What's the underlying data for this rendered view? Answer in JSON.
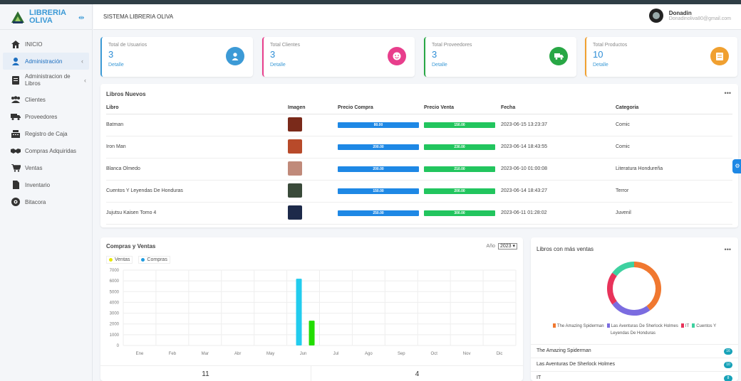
{
  "brand": {
    "line1": "LIBRERIA",
    "line2": "OLIVA",
    "collapse_icon": "collapse-icon"
  },
  "sidebar": {
    "items": [
      {
        "label": "INICIO",
        "icon": "home-icon"
      },
      {
        "label": "Administración",
        "icon": "user-icon",
        "active": true
      },
      {
        "label": "Administracion de Libros",
        "icon": "book-icon"
      },
      {
        "label": "Clientes",
        "icon": "users-icon"
      },
      {
        "label": "Proveedores",
        "icon": "truck-icon"
      },
      {
        "label": "Registro de Caja",
        "icon": "cash-register-icon"
      },
      {
        "label": "Compras Adquiridas",
        "icon": "handshake-icon"
      },
      {
        "label": "Ventas",
        "icon": "cart-icon"
      },
      {
        "label": "Inventario",
        "icon": "file-icon"
      },
      {
        "label": "Bitacora",
        "icon": "eye-icon"
      }
    ]
  },
  "header": {
    "title": "SISTEMA LIBRERIA OLIVA",
    "user_name": "Donadin",
    "user_email": "Donadinoliva80@gmail.com"
  },
  "stats": [
    {
      "label": "Total de Usuarios",
      "value": "3",
      "link": "Detalle",
      "color": "#3c9ad6",
      "icon": "user-icon"
    },
    {
      "label": "Total Clientes",
      "value": "3",
      "link": "Detalle",
      "color": "#e83e8c",
      "icon": "smile-icon"
    },
    {
      "label": "Total Proveedores",
      "value": "3",
      "link": "Detalle",
      "color": "#28a745",
      "icon": "truck-icon"
    },
    {
      "label": "Total Productos",
      "value": "10",
      "link": "Detalle",
      "color": "#f0a030",
      "icon": "box-icon"
    }
  ],
  "libros": {
    "title": "Libros Nuevos",
    "headers": [
      "Libro",
      "Imagen",
      "Precio Compra",
      "Precio Venta",
      "Fecha",
      "Categoria"
    ],
    "rows": [
      {
        "libro": "Batman",
        "compra": "80.00",
        "venta": "150.00",
        "fecha": "2023-06-15 13:23:37",
        "categoria": "Comic",
        "img": "#7a2a1a"
      },
      {
        "libro": "Iron Man",
        "compra": "200.00",
        "venta": "230.00",
        "fecha": "2023-06-14 18:43:55",
        "categoria": "Comic",
        "img": "#b84a2a"
      },
      {
        "libro": "Blanca Olmedo",
        "compra": "200.00",
        "venta": "210.00",
        "fecha": "2023-06-10 01:00:08",
        "categoria": "Literatura Hondureña",
        "img": "#c08a7a"
      },
      {
        "libro": "Cuentos Y Leyendas De Honduras",
        "compra": "150.00",
        "venta": "200.00",
        "fecha": "2023-06-14 18:43:27",
        "categoria": "Terror",
        "img": "#3a4a3a"
      },
      {
        "libro": "Jujutsu Kaisen Tomo 4",
        "compra": "250.00",
        "venta": "300.00",
        "fecha": "2023-06-11 01:28:02",
        "categoria": "Juvenil",
        "img": "#1d2a4a"
      }
    ]
  },
  "compras_ventas": {
    "title": "Compras y Ventas",
    "year_label": "Año",
    "year": "2023",
    "footer_left": "11",
    "footer_right": "4"
  },
  "chart_data": {
    "type": "bar",
    "categories": [
      "Ene",
      "Feb",
      "Mar",
      "Abr",
      "May",
      "Jun",
      "Jul",
      "Ago",
      "Sep",
      "Oct",
      "Nov",
      "Dic"
    ],
    "series": [
      {
        "name": "Ventas",
        "color": "#22dd00",
        "values": [
          0,
          0,
          0,
          0,
          0,
          2300,
          0,
          0,
          0,
          0,
          0,
          0
        ]
      },
      {
        "name": "Compras",
        "color": "#22ccee",
        "values": [
          0,
          0,
          0,
          0,
          0,
          6200,
          0,
          0,
          0,
          0,
          0,
          0
        ]
      }
    ],
    "yticks": [
      "7000",
      "6000",
      "5000",
      "4000",
      "3000",
      "2000",
      "1000",
      "0"
    ],
    "ylim": [
      0,
      7000
    ],
    "grid": true,
    "legend": "top-left"
  },
  "mas_ventas": {
    "title": "Libros con más ventas",
    "donut": [
      {
        "name": "The Amazing Spiderman",
        "value": 16,
        "color": "#f07830"
      },
      {
        "name": "Las Aventuras De Sherlock Holmes",
        "value": 10,
        "color": "#7b6ce0"
      },
      {
        "name": "IT",
        "value": 8,
        "color": "#e8335a"
      },
      {
        "name": "Cuentos Y Leyendas De Honduras",
        "value": 6,
        "color": "#3ed1a0"
      }
    ],
    "list": [
      {
        "label": "The Amazing Spiderman",
        "badge": "16"
      },
      {
        "label": "Las Aventuras De Sherlock Holmes",
        "badge": "10"
      },
      {
        "label": "IT",
        "badge": "8"
      }
    ]
  }
}
